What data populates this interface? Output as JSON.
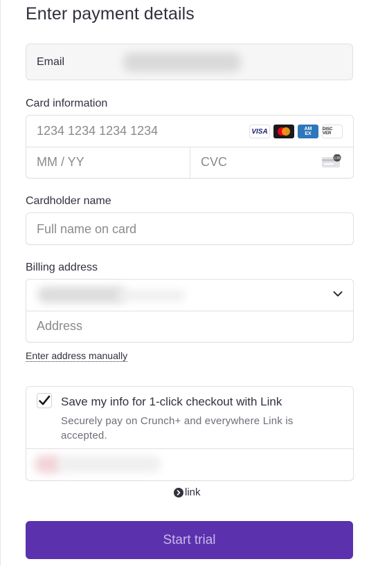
{
  "header": {
    "title": "Enter payment details"
  },
  "email": {
    "label": "Email"
  },
  "card": {
    "section_label": "Card information",
    "number_placeholder": "1234 1234 1234 1234",
    "expiry_placeholder": "MM / YY",
    "cvc_placeholder": "CVC",
    "brands": {
      "visa": "VISA",
      "amex_line1": "AM",
      "amex_line2": "EX",
      "discover": "DISC VER"
    },
    "cvc_badge": "135"
  },
  "cardholder": {
    "section_label": "Cardholder name",
    "placeholder": "Full name on card"
  },
  "billing": {
    "section_label": "Billing address",
    "address_placeholder": "Address",
    "manual_link": "Enter address manually"
  },
  "link_save": {
    "checked": true,
    "title": "Save my info for 1-click checkout with Link",
    "description": "Securely pay on Crunch+ and everywhere Link is accepted."
  },
  "link_brand": {
    "text": "link"
  },
  "cta": {
    "label": "Start trial"
  },
  "colors": {
    "primary": "#5b31ad",
    "primary_text": "#c8b8ea",
    "text": "#30313d",
    "muted": "#6d6e78",
    "border": "#e0e0e0"
  }
}
